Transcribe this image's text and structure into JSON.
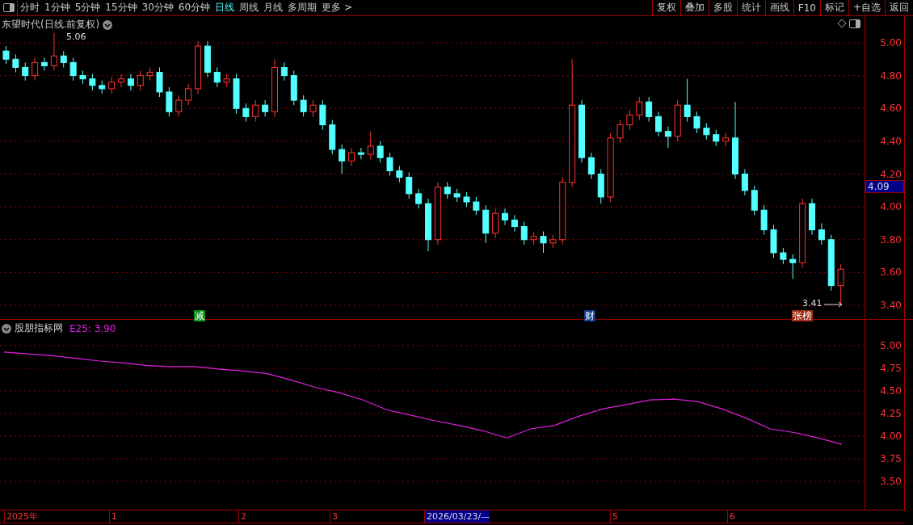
{
  "toolbar": {
    "periods": [
      {
        "label": "分时",
        "selected": false
      },
      {
        "label": "1分钟",
        "selected": false
      },
      {
        "label": "5分钟",
        "selected": false
      },
      {
        "label": "15分钟",
        "selected": false
      },
      {
        "label": "30分钟",
        "selected": false
      },
      {
        "label": "60分钟",
        "selected": false
      },
      {
        "label": "日线",
        "selected": true
      },
      {
        "label": "周线",
        "selected": false
      },
      {
        "label": "月线",
        "selected": false
      },
      {
        "label": "多周期",
        "selected": false
      },
      {
        "label": "更多 >",
        "selected": false
      }
    ],
    "buttons": [
      "复权",
      "叠加",
      "多股",
      "统计",
      "画线",
      "F10",
      "标记",
      "+自选",
      "返回"
    ]
  },
  "price_panel": {
    "title": "东望时代(日线.前复权)",
    "high_label": "5.06",
    "low_label": "3.41",
    "current_price": "4.09",
    "tags": [
      {
        "text": "减",
        "color": "#0a8a1a"
      },
      {
        "text": "财",
        "color": "#0d3a8c"
      },
      {
        "text": "张榜",
        "color": "#9a2a10"
      }
    ],
    "chart_data": {
      "type": "candlestick",
      "ylim": [
        3.4,
        5.0
      ],
      "grid": true,
      "yticks": [
        {
          "value": 5.0,
          "label": "5.00"
        },
        {
          "value": 4.8,
          "label": "4.80"
        },
        {
          "value": 4.6,
          "label": "4.60"
        },
        {
          "value": 4.4,
          "label": "4.40"
        },
        {
          "value": 4.2,
          "label": "4.20"
        },
        {
          "value": 4.0,
          "label": "4.00"
        },
        {
          "value": 3.8,
          "label": "3.80"
        },
        {
          "value": 3.6,
          "label": "3.60"
        },
        {
          "value": 3.4,
          "label": "3.40"
        }
      ],
      "ohlc": [
        [
          4.95,
          4.98,
          4.87,
          4.9
        ],
        [
          4.9,
          4.93,
          4.82,
          4.85
        ],
        [
          4.85,
          4.88,
          4.77,
          4.8
        ],
        [
          4.8,
          4.91,
          4.77,
          4.88
        ],
        [
          4.88,
          4.91,
          4.83,
          4.86
        ],
        [
          4.86,
          5.06,
          4.83,
          4.92
        ],
        [
          4.92,
          4.95,
          4.85,
          4.88
        ],
        [
          4.88,
          4.91,
          4.77,
          4.8
        ],
        [
          4.8,
          4.83,
          4.75,
          4.78
        ],
        [
          4.78,
          4.81,
          4.71,
          4.74
        ],
        [
          4.74,
          4.77,
          4.69,
          4.72
        ],
        [
          4.72,
          4.79,
          4.69,
          4.76
        ],
        [
          4.76,
          4.81,
          4.73,
          4.78
        ],
        [
          4.78,
          4.81,
          4.71,
          4.74
        ],
        [
          4.74,
          4.83,
          4.71,
          4.8
        ],
        [
          4.8,
          4.85,
          4.77,
          4.82
        ],
        [
          4.82,
          4.85,
          4.67,
          4.7
        ],
        [
          4.7,
          4.73,
          4.55,
          4.58
        ],
        [
          4.58,
          4.68,
          4.55,
          4.65
        ],
        [
          4.65,
          4.75,
          4.62,
          4.72
        ],
        [
          4.72,
          5.01,
          4.69,
          4.98
        ],
        [
          4.98,
          5.01,
          4.79,
          4.82
        ],
        [
          4.82,
          4.85,
          4.73,
          4.76
        ],
        [
          4.76,
          4.81,
          4.73,
          4.78
        ],
        [
          4.78,
          4.81,
          4.57,
          4.6
        ],
        [
          4.6,
          4.63,
          4.52,
          4.55
        ],
        [
          4.55,
          4.65,
          4.52,
          4.62
        ],
        [
          4.62,
          4.65,
          4.55,
          4.58
        ],
        [
          4.58,
          4.9,
          4.55,
          4.85
        ],
        [
          4.85,
          4.88,
          4.77,
          4.8
        ],
        [
          4.8,
          4.83,
          4.62,
          4.65
        ],
        [
          4.65,
          4.68,
          4.55,
          4.58
        ],
        [
          4.58,
          4.65,
          4.55,
          4.62
        ],
        [
          4.62,
          4.65,
          4.47,
          4.5
        ],
        [
          4.5,
          4.53,
          4.32,
          4.35
        ],
        [
          4.35,
          4.38,
          4.2,
          4.28
        ],
        [
          4.28,
          4.36,
          4.25,
          4.33
        ],
        [
          4.33,
          4.36,
          4.29,
          4.32
        ],
        [
          4.32,
          4.46,
          4.29,
          4.37
        ],
        [
          4.37,
          4.4,
          4.27,
          4.3
        ],
        [
          4.3,
          4.33,
          4.19,
          4.22
        ],
        [
          4.22,
          4.25,
          4.15,
          4.18
        ],
        [
          4.18,
          4.21,
          4.05,
          4.08
        ],
        [
          4.08,
          4.11,
          3.99,
          4.02
        ],
        [
          4.02,
          4.05,
          3.73,
          3.8
        ],
        [
          3.8,
          4.15,
          3.77,
          4.12
        ],
        [
          4.12,
          4.15,
          4.05,
          4.08
        ],
        [
          4.08,
          4.11,
          4.03,
          4.06
        ],
        [
          4.06,
          4.09,
          4.0,
          4.03
        ],
        [
          4.03,
          4.06,
          3.95,
          3.98
        ],
        [
          3.98,
          4.01,
          3.78,
          3.84
        ],
        [
          3.84,
          3.99,
          3.81,
          3.96
        ],
        [
          3.96,
          3.99,
          3.89,
          3.92
        ],
        [
          3.92,
          3.95,
          3.85,
          3.88
        ],
        [
          3.88,
          3.91,
          3.77,
          3.8
        ],
        [
          3.8,
          3.85,
          3.77,
          3.82
        ],
        [
          3.82,
          3.85,
          3.72,
          3.78
        ],
        [
          3.78,
          3.83,
          3.75,
          3.8
        ],
        [
          3.8,
          4.18,
          3.77,
          4.15
        ],
        [
          4.15,
          4.9,
          4.12,
          4.62
        ],
        [
          4.62,
          4.65,
          4.27,
          4.3
        ],
        [
          4.3,
          4.33,
          4.17,
          4.2
        ],
        [
          4.2,
          4.23,
          4.02,
          4.06
        ],
        [
          4.06,
          4.45,
          4.03,
          4.42
        ],
        [
          4.42,
          4.53,
          4.39,
          4.5
        ],
        [
          4.5,
          4.59,
          4.47,
          4.56
        ],
        [
          4.56,
          4.67,
          4.53,
          4.64
        ],
        [
          4.64,
          4.67,
          4.52,
          4.55
        ],
        [
          4.55,
          4.58,
          4.43,
          4.46
        ],
        [
          4.46,
          4.49,
          4.36,
          4.43
        ],
        [
          4.43,
          4.65,
          4.4,
          4.62
        ],
        [
          4.62,
          4.78,
          4.52,
          4.55
        ],
        [
          4.55,
          4.58,
          4.45,
          4.48
        ],
        [
          4.48,
          4.51,
          4.41,
          4.44
        ],
        [
          4.44,
          4.47,
          4.37,
          4.4
        ],
        [
          4.4,
          4.45,
          4.37,
          4.42
        ],
        [
          4.42,
          4.64,
          4.17,
          4.2
        ],
        [
          4.2,
          4.23,
          4.07,
          4.1
        ],
        [
          4.1,
          4.13,
          3.95,
          3.98
        ],
        [
          3.98,
          4.01,
          3.83,
          3.86
        ],
        [
          3.86,
          3.89,
          3.69,
          3.72
        ],
        [
          3.72,
          3.75,
          3.65,
          3.68
        ],
        [
          3.68,
          3.71,
          3.56,
          3.66
        ],
        [
          3.66,
          4.05,
          3.63,
          4.02
        ],
        [
          4.02,
          4.05,
          3.83,
          3.86
        ],
        [
          3.86,
          3.9,
          3.77,
          3.8
        ],
        [
          3.8,
          3.83,
          3.49,
          3.52
        ],
        [
          3.52,
          3.65,
          3.41,
          3.62
        ]
      ]
    }
  },
  "indicator_panel": {
    "title": "股朋指标网",
    "value_label": ": 3.90",
    "chart_data": {
      "type": "line",
      "ylim": [
        3.5,
        5.0
      ],
      "grid": true,
      "yticks": [
        {
          "value": 5.0,
          "label": "5.00"
        },
        {
          "value": 4.75,
          "label": "4.75"
        },
        {
          "value": 4.5,
          "label": "4.50"
        },
        {
          "value": 4.25,
          "label": "4.25"
        },
        {
          "value": 4.0,
          "label": "4.00"
        },
        {
          "value": 3.75,
          "label": "3.75"
        },
        {
          "value": 3.5,
          "label": "3.50"
        }
      ],
      "series": [
        {
          "name": "E25",
          "color": "#e020e0",
          "values": [
            4.93,
            4.91,
            4.89,
            4.86,
            4.83,
            4.81,
            4.78,
            4.77,
            4.77,
            4.74,
            4.72,
            4.69,
            4.62,
            4.54,
            4.48,
            4.4,
            4.29,
            4.23,
            4.17,
            4.12,
            4.06,
            3.98,
            4.08,
            4.12,
            4.22,
            4.3,
            4.35,
            4.4,
            4.41,
            4.38,
            4.3,
            4.2,
            4.08,
            4.04,
            3.98,
            3.91
          ]
        }
      ]
    }
  },
  "time_axis": [
    {
      "label": "2025年",
      "selected": false
    },
    {
      "label": "1",
      "selected": false
    },
    {
      "label": "2",
      "selected": false
    },
    {
      "label": "3",
      "selected": false
    },
    {
      "label": "2026/03/23/—",
      "selected": true
    },
    {
      "label": "5",
      "selected": false
    },
    {
      "label": "6",
      "selected": false
    }
  ]
}
